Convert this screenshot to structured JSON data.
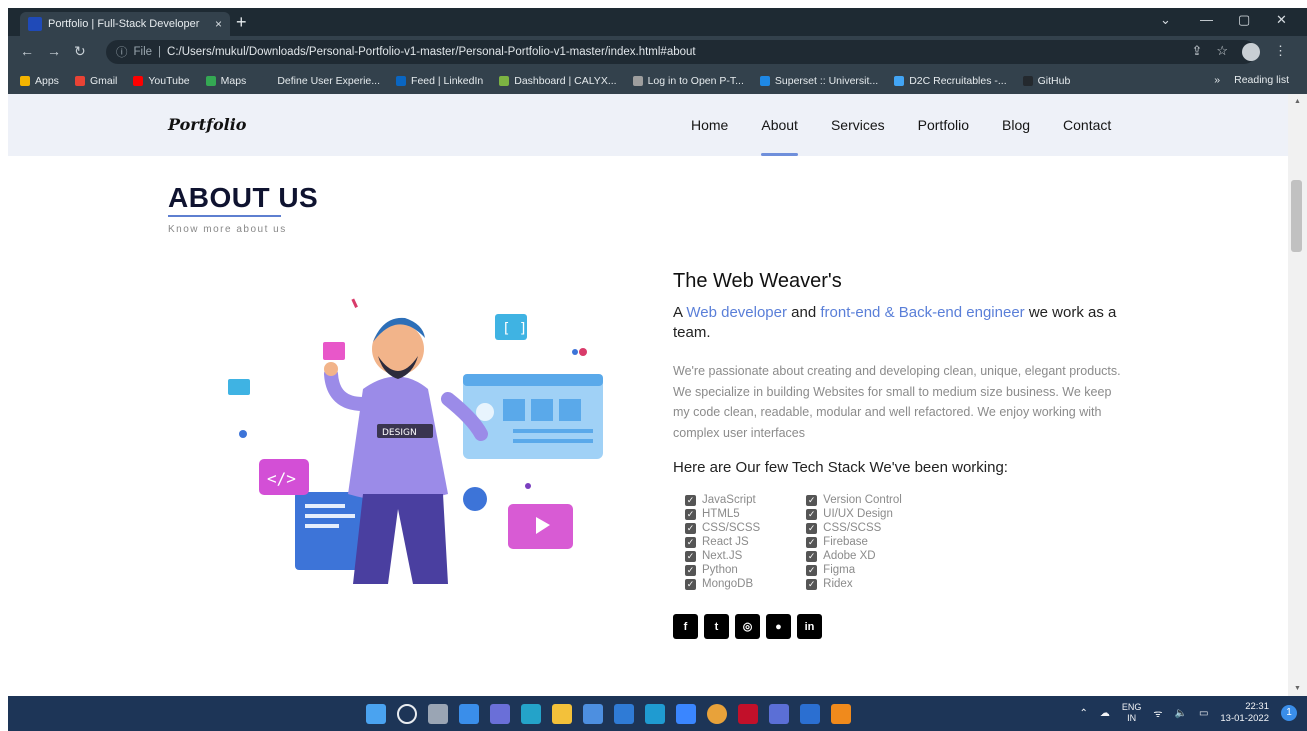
{
  "browser": {
    "tab_title": "Portfolio | Full-Stack Developer",
    "tab_close": "×",
    "new_tab": "+",
    "address_scheme": "File",
    "address_url": "C:/Users/mukul/Downloads/Personal-Portfolio-v1-master/Personal-Portfolio-v1-master/index.html#about",
    "bookmarks": [
      {
        "label": "Apps",
        "color": "#f4b400"
      },
      {
        "label": "Gmail",
        "color": "#ea4335"
      },
      {
        "label": "YouTube",
        "color": "#ff0000"
      },
      {
        "label": "Maps",
        "color": "#34a853"
      },
      {
        "label": "Define User Experie...",
        "color": "#33414c"
      },
      {
        "label": "Feed | LinkedIn",
        "color": "#0a66c2"
      },
      {
        "label": "Dashboard | CALYX...",
        "color": "#7cb342"
      },
      {
        "label": "Log in to Open P-T...",
        "color": "#9e9e9e"
      },
      {
        "label": "Superset :: Universit...",
        "color": "#1e88e5"
      },
      {
        "label": "D2C Recruitables -...",
        "color": "#42a5f5"
      },
      {
        "label": "GitHub",
        "color": "#24292e"
      }
    ],
    "bookmarks_more": "»",
    "reading_list": "Reading list"
  },
  "site": {
    "logo": "Portfolio",
    "nav": [
      "Home",
      "About",
      "Services",
      "Portfolio",
      "Blog",
      "Contact"
    ],
    "active_nav": "About"
  },
  "about": {
    "title": "ABOUT US",
    "subtitle": "Know more about us",
    "heading": "The Web Weaver's",
    "tagline_a": "A ",
    "tagline_hl1": "Web developer",
    "tagline_b": " and ",
    "tagline_hl2": "front-end & Back-end engineer",
    "tagline_c": " we work as a team.",
    "description": "We're passionate about creating and developing clean, unique, elegant products. We specialize in building Websites for small to medium size business. We keep my code clean, readable, modular and well refactored. We enjoy working with complex user interfaces",
    "stack_heading": "Here are Our few Tech Stack We've been working:",
    "stack_left": [
      "JavaScript",
      "HTML5",
      "CSS/SCSS",
      "React JS",
      "Next.JS",
      "Python",
      "MongoDB"
    ],
    "stack_right": [
      "Version Control",
      "UI/UX Design",
      "CSS/SCSS",
      "Firebase",
      "Adobe XD",
      "Figma",
      "Ridex"
    ],
    "illustration_badge": "DESIGN",
    "socials": [
      "f",
      "t",
      "ig",
      "gh",
      "in"
    ]
  },
  "taskbar": {
    "lang_top": "ENG",
    "lang_bottom": "IN",
    "time": "22:31",
    "date": "13-01-2022",
    "notifications": "1"
  }
}
